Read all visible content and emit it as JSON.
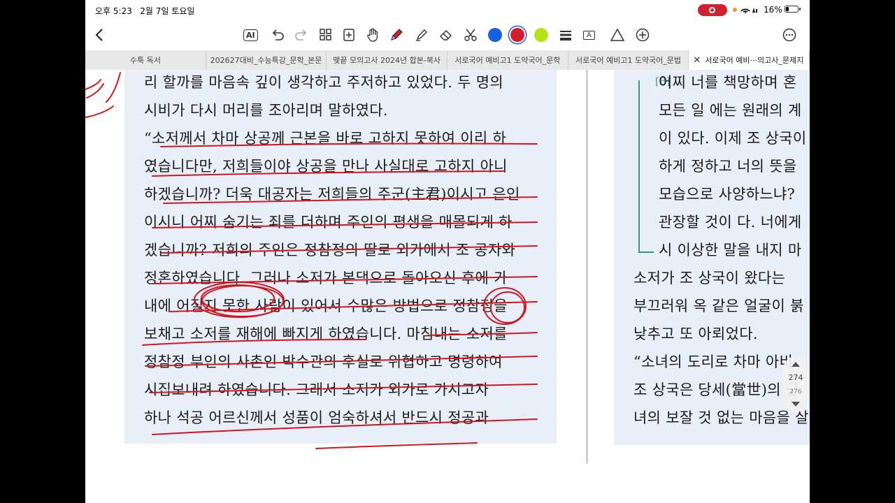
{
  "status": {
    "time": "오후 5:23",
    "date": "2월 7일 토요일",
    "battery": "16%"
  },
  "toolbar": {
    "buttons": [
      "back-icon",
      "ai-icon",
      "undo-icon",
      "redo-icon",
      "grid-icon",
      "add-page-icon",
      "hand-icon",
      "pen-icon",
      "highlighter-icon",
      "eraser-icon",
      "scissors-icon",
      "color-blue",
      "color-red",
      "color-green",
      "line-icon",
      "text-box-icon",
      "shape-icon",
      "add-icon",
      "more-icon"
    ],
    "ai_label": "AI",
    "text_label": "A",
    "colors": {
      "blue": "#1a5fe0",
      "red": "#d21f2d",
      "green": "#b4e21e"
    }
  },
  "tabs": [
    {
      "label": "수특 독서"
    },
    {
      "label": "202627대비_수능특강_문학_본문"
    },
    {
      "label": "맺끝 모의고사 2024년 합본-복사"
    },
    {
      "label": "서로국어 예비고1 도약국어_문학"
    },
    {
      "label": "서로국어 예비고1 도약국어_문법"
    },
    {
      "label": "서로국어 예비···의고사_문제지",
      "active": true
    }
  ],
  "pageA": {
    "lines": [
      "리 할까를 마음속 깊이 생각하고 주저하고 있었다. 두 명의",
      "시비가 다시 머리를 조아리며 말하였다.",
      "  “소저께서 차마 상공께 근본을 바로 고하지 못하여 이리 하",
      "였습니다만, 저희들이야 상공을 만나 사실대로 고하지 아니",
      "하겠습니까? 더욱 대공자는 저희들의 주군(主君)이시고 은인",
      "이시니 어찌 숨기는 죄를 더하며 주인의 평생을 매몰되게 하",
      "겠습니까? 저희의 주인은 정참정의 딸로 외가에서 조 공자와",
      "정혼하였습니다. 그러나 소저가 본댁으로 돌아오신 후에 가",
      "내에 어질지 못한 사람이 있어서 수많은 방법으로 정참정을",
      "보채고 소저를 재해에 빠지게 하였습니다. 마침내는 소저를",
      "정참정 부인의 사촌인 박수관의 후실로 위협하고 명령하여",
      "시집보내려 하였습니다. 그래서 소저가 외가로 가시고자",
      "하나 석공 어르신께서 성품이 엄숙하셔서 반드시 정공과"
    ]
  },
  "pageB": {
    "bracket_label": "[B]",
    "lines": [
      "어찌 너를 책망하며 혼",
      "모든 일 에는 원래의 계",
      "이 있다. 이제 조 상국이",
      "하게 정하고 너의 뜻을",
      "모습으로 사양하느냐?",
      "관장할 것이 다. 너에게",
      "시 이상한 말을 내지 마",
      "  소저가 조 상국이 왔다는",
      "부끄러워 옥 같은 얼굴이 붉",
      "낮추고 또 아뢰었다.",
      "  “소녀의 도리로 차마 아비",
      "조 상국은 당세(當世)의 군",
      "녀의 보잘 것 없는 마음을 살"
    ]
  },
  "page_indicator": {
    "current": "274",
    "total": "276"
  }
}
